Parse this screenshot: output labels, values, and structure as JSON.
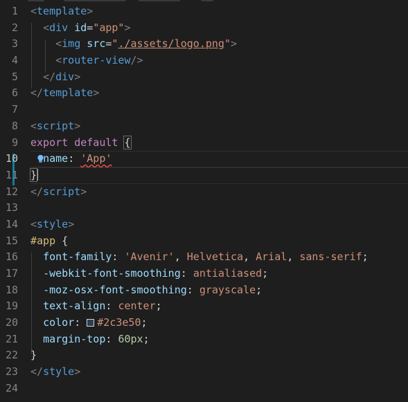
{
  "editor": {
    "line_numbers": [
      "1",
      "2",
      "3",
      "4",
      "5",
      "6",
      "7",
      "8",
      "9",
      "10",
      "11",
      "12",
      "13",
      "14",
      "15",
      "16",
      "17",
      "18",
      "19",
      "20",
      "21",
      "22",
      "23",
      "24"
    ],
    "active_line": "10",
    "lines": {
      "l1": {
        "open": "<",
        "tag": "template",
        "close": ">"
      },
      "l2": {
        "open": "<",
        "tag": "div",
        "attr": "id",
        "eq": "=",
        "val": "\"app\"",
        "close": ">"
      },
      "l3": {
        "open": "<",
        "tag": "img",
        "attr": "src",
        "eq": "=",
        "q1": "\"",
        "val": "./assets/logo.png",
        "q2": "\"",
        "close": ">"
      },
      "l4": {
        "open": "<",
        "tag": "router-view",
        "close": "/>"
      },
      "l5": {
        "open": "</",
        "tag": "div",
        "close": ">"
      },
      "l6": {
        "open": "</",
        "tag": "template",
        "close": ">"
      },
      "l8": {
        "open": "<",
        "tag": "script",
        "close": ">"
      },
      "l9": {
        "kw1": "export",
        "kw2": "default",
        "brace": "{"
      },
      "l10": {
        "prop": "name",
        "colon": ": ",
        "val": "'App'"
      },
      "l11": {
        "brace": "}"
      },
      "l12": {
        "open": "</",
        "tag": "script",
        "close": ">"
      },
      "l14": {
        "open": "<",
        "tag": "style",
        "close": ">"
      },
      "l15": {
        "selector": "#app",
        "brace": "{"
      },
      "l16": {
        "prop": "font-family",
        "colon": ": ",
        "v1": "'Avenir'",
        "c1": ", ",
        "v2": "Helvetica",
        "c2": ", ",
        "v3": "Arial",
        "c3": ", ",
        "v4": "sans-serif",
        "end": ";"
      },
      "l17": {
        "prop": "-webkit-font-smoothing",
        "colon": ": ",
        "val": "antialiased",
        "end": ";"
      },
      "l18": {
        "prop": "-moz-osx-font-smoothing",
        "colon": ": ",
        "val": "grayscale",
        "end": ";"
      },
      "l19": {
        "prop": "text-align",
        "colon": ": ",
        "val": "center",
        "end": ";"
      },
      "l20": {
        "prop": "color",
        "colon": ": ",
        "val": "#2c3e50",
        "end": ";"
      },
      "l21": {
        "prop": "margin-top",
        "colon": ": ",
        "val": "60px",
        "end": ";"
      },
      "l22": {
        "brace": "}"
      },
      "l23": {
        "open": "</",
        "tag": "style",
        "close": ">"
      }
    }
  },
  "colors": {
    "background": "#1e1e1e",
    "tag": "#569cd6",
    "attribute": "#9cdcfe",
    "string": "#ce9178",
    "keyword": "#c586c0",
    "selector": "#d7ba7d",
    "number": "#b5cea8",
    "swatch": "#2c3e50"
  },
  "icons": {
    "lightbulb": "lightbulb-icon",
    "color_swatch": "color-swatch-icon"
  }
}
